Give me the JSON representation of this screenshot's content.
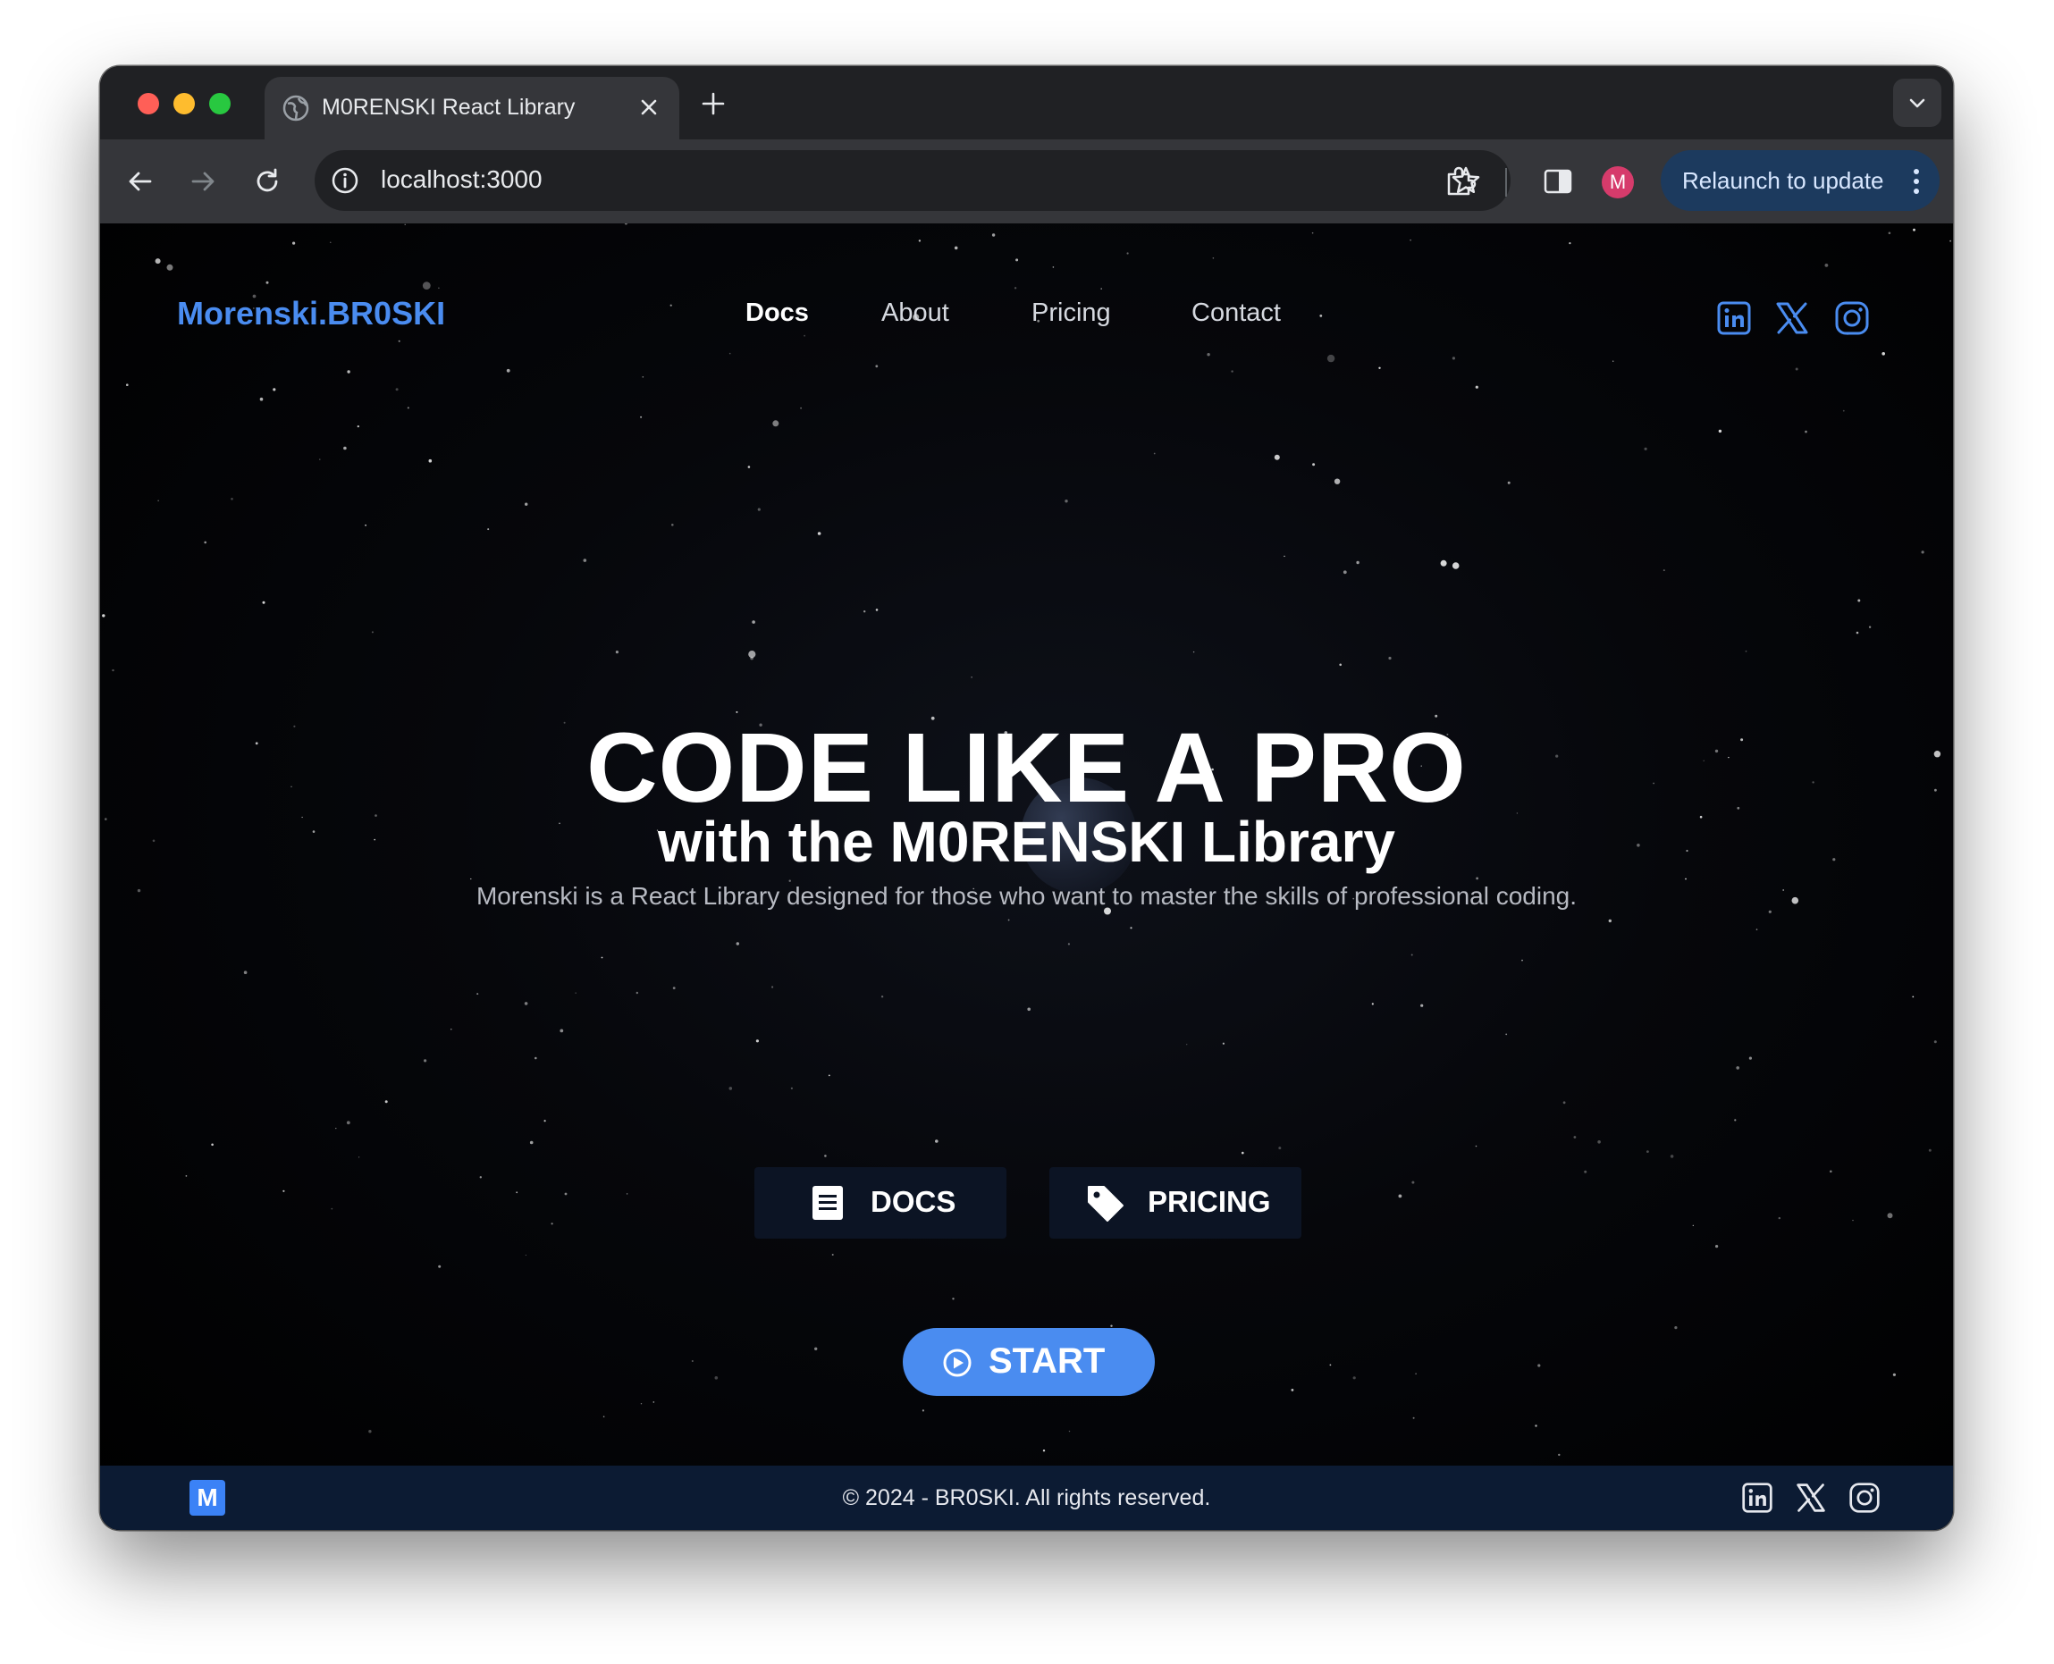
{
  "browser": {
    "tab_title": "M0RENSKI React Library",
    "url": "localhost:3000",
    "relaunch_label": "Relaunch to update",
    "profile_initial": "M"
  },
  "site": {
    "brand": "Morenski.BR0SKI",
    "nav": [
      {
        "label": "Docs",
        "active": true
      },
      {
        "label": "About"
      },
      {
        "label": "Pricing"
      },
      {
        "label": "Contact"
      }
    ],
    "social_icons": [
      "linkedin-icon",
      "x-icon",
      "instagram-icon"
    ]
  },
  "hero": {
    "title": "CODE LIKE A PRO",
    "subtitle": "with the M0RENSKI Library",
    "description": "Morenski is a React Library designed for those who want to master the skills of professional coding."
  },
  "buttons": {
    "docs": "DOCS",
    "pricing": "PRICING",
    "start": "START"
  },
  "footer": {
    "logo_letter": "M",
    "copyright": "© 2024 - BR0SKI. All rights reserved."
  },
  "colors": {
    "accent": "#4a8cf0",
    "page_bg": "#000000",
    "footer_bg": "#0c1b33",
    "button_bg": "#0c1424"
  }
}
